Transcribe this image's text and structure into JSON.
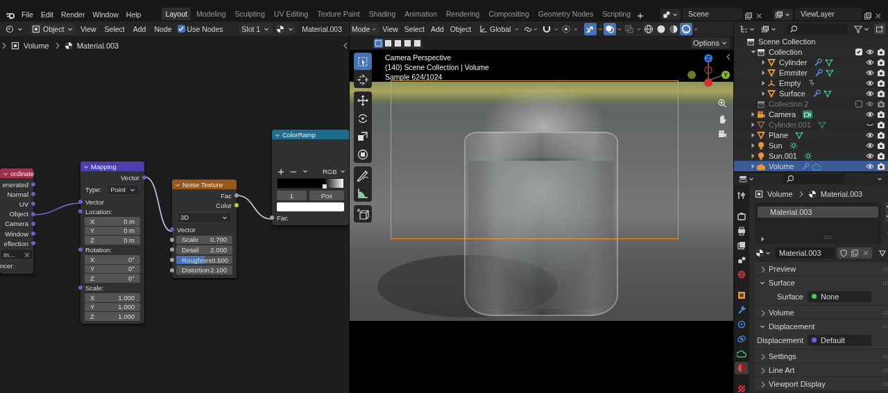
{
  "topbar": {
    "menus": [
      "File",
      "Edit",
      "Render",
      "Window",
      "Help"
    ],
    "workspaces": [
      {
        "label": "Layout",
        "selected": true
      },
      {
        "label": "Modeling",
        "selected": false
      },
      {
        "label": "Sculpting",
        "selected": false
      },
      {
        "label": "UV Editing",
        "selected": false
      },
      {
        "label": "Texture Paint",
        "selected": false
      },
      {
        "label": "Shading",
        "selected": false
      },
      {
        "label": "Animation",
        "selected": false
      },
      {
        "label": "Rendering",
        "selected": false
      },
      {
        "label": "Compositing",
        "selected": false
      },
      {
        "label": "Geometry Nodes",
        "selected": false
      },
      {
        "label": "Scripting",
        "selected": false
      }
    ],
    "scene": "Scene",
    "view_layer": "ViewLayer"
  },
  "node_editor": {
    "header": {
      "mode": "Object",
      "menus": [
        "View",
        "Select",
        "Add",
        "Node"
      ],
      "use_nodes": {
        "label": "Use Nodes",
        "checked": true
      },
      "slot": "Slot 1",
      "material": "Material.003"
    },
    "breadcrumb": [
      "Volume",
      "Material.003"
    ],
    "nodes": [
      {
        "title": "ordinate",
        "color": "#a3304a",
        "rows": [
          {
            "kind": "output",
            "label": "enerated",
            "color": "#6363c7"
          },
          {
            "kind": "output",
            "label": "Normal",
            "color": "#6363c7"
          },
          {
            "kind": "output",
            "label": "UV",
            "color": "#6363c7"
          },
          {
            "kind": "output",
            "label": "Object",
            "color": "#6363c7"
          },
          {
            "kind": "output",
            "label": "Camera",
            "color": "#6363c7"
          },
          {
            "kind": "output",
            "label": "Window",
            "color": "#6363c7"
          },
          {
            "kind": "output",
            "label": "eflection",
            "color": "#6363c7"
          },
          {
            "kind": "object",
            "value": "m…"
          },
          {
            "kind": "text",
            "label": "ncer"
          }
        ]
      },
      {
        "title": "Mapping",
        "color": "#4a40b0",
        "rows": [
          {
            "kind": "output",
            "label": "Vector",
            "color": "#6363c7"
          },
          {
            "kind": "dropdown",
            "label": "Type:",
            "value": "Point"
          },
          {
            "kind": "input",
            "label": "Vector",
            "color": "#6363c7"
          },
          {
            "kind": "input",
            "label": "Location:",
            "color": "#6363c7"
          },
          {
            "kind": "field",
            "label": "X",
            "value": "0 m"
          },
          {
            "kind": "field",
            "label": "Y",
            "value": "0 m"
          },
          {
            "kind": "field",
            "label": "Z",
            "value": "0 m"
          },
          {
            "kind": "input",
            "label": "Rotation:",
            "color": "#6363c7"
          },
          {
            "kind": "field",
            "label": "X",
            "value": "0°"
          },
          {
            "kind": "field",
            "label": "Y",
            "value": "0°"
          },
          {
            "kind": "field",
            "label": "Z",
            "value": "0°"
          },
          {
            "kind": "input",
            "label": "Scale:",
            "color": "#6363c7"
          },
          {
            "kind": "field",
            "label": "X",
            "value": "1.000"
          },
          {
            "kind": "field",
            "label": "Y",
            "value": "1.000"
          },
          {
            "kind": "field",
            "label": "Z",
            "value": "1.000"
          }
        ]
      },
      {
        "title": "Noise Texture",
        "color": "#96581c",
        "rows": [
          {
            "kind": "output",
            "label": "Fac",
            "color": "#a1a1a1"
          },
          {
            "kind": "output",
            "label": "Color",
            "color": "#c7c729"
          },
          {
            "kind": "dropdown",
            "value": "3D"
          },
          {
            "kind": "input",
            "label": "Vector",
            "color": "#6363c7"
          },
          {
            "kind": "slider",
            "label": "Scale",
            "value": "0.700",
            "color": "#a1a1a1"
          },
          {
            "kind": "slider",
            "label": "Detail",
            "value": "2.000",
            "color": "#a1a1a1"
          },
          {
            "kind": "slider",
            "label": "Roughnes",
            "value": "0.500",
            "color": "#a1a1a1",
            "level": 0.5
          },
          {
            "kind": "slider",
            "label": "Distortion",
            "value": "2.100",
            "color": "#a1a1a1"
          }
        ]
      },
      {
        "title": "ColorRamp",
        "color": "#1f6d8c",
        "rows": [
          {
            "kind": "ramp-controls",
            "mode": "RGB"
          },
          {
            "kind": "gradient",
            "level": 0.7
          },
          {
            "kind": "ramp-stop",
            "index": "1",
            "position": "Pos"
          },
          {
            "kind": "swatch",
            "color": "#ffffff"
          },
          {
            "kind": "input",
            "label": "Fac",
            "color": "#a1a1a1"
          }
        ]
      }
    ]
  },
  "viewport": {
    "header": {
      "mode": "Mode",
      "menus": [
        "View",
        "Select",
        "Add",
        "Object"
      ],
      "orientation": "Global",
      "toggles": [
        {
          "kind": "snap",
          "on": false
        },
        {
          "kind": "proportional",
          "on": false
        },
        {
          "kind": "gizmos",
          "on": true
        },
        {
          "kind": "overlays",
          "on": true
        },
        {
          "kind": "xray",
          "on": false
        }
      ],
      "shading": [
        {
          "kind": "wireframe",
          "selected": false
        },
        {
          "kind": "solid",
          "selected": false
        },
        {
          "kind": "material",
          "selected": false
        },
        {
          "kind": "rendered",
          "selected": true
        }
      ]
    },
    "select_modes": [
      {
        "selected": true
      },
      {
        "selected": false
      },
      {
        "selected": false
      },
      {
        "selected": false
      },
      {
        "selected": false
      }
    ],
    "options": "Options",
    "overlay": [
      "Camera Perspective",
      "(140) Scene Collection | Volume",
      "Sample 624/1024"
    ],
    "tools": [
      {
        "kind": "select",
        "selected": true
      },
      {
        "kind": "cursor",
        "selected": false
      },
      {
        "kind": "move",
        "selected": false
      },
      {
        "kind": "rotate",
        "selected": false
      },
      {
        "kind": "scale",
        "selected": false
      },
      {
        "kind": "transform",
        "selected": false
      },
      {
        "kind": "annotate",
        "selected": false
      },
      {
        "kind": "measure",
        "selected": false
      },
      {
        "kind": "add-cube",
        "selected": false
      }
    ],
    "gizmo": {
      "z": "Z",
      "y": "Y"
    }
  },
  "outliner": {
    "tree": [
      {
        "name": "Scene Collection",
        "kind": "scene",
        "selected": false,
        "children": [
          {
            "name": "Collection",
            "kind": "collection",
            "expanded": true,
            "included": true,
            "selected": false,
            "children": [
              {
                "name": "Cylinder",
                "kind": "mesh",
                "expanded": false,
                "modifier": true,
                "visible": true,
                "selected": false
              },
              {
                "name": "Emmiter",
                "kind": "mesh",
                "expanded": false,
                "modifier": true,
                "visible": true,
                "selected": false
              },
              {
                "name": "Empty",
                "kind": "empty",
                "expanded": false,
                "modifier": false,
                "visible": true,
                "selected": false
              },
              {
                "name": "Surface",
                "kind": "mesh",
                "expanded": false,
                "modifier": true,
                "visible": true,
                "selected": false
              }
            ]
          },
          {
            "name": "Collection 2",
            "kind": "collection",
            "included": false,
            "selected": false
          },
          {
            "name": "Camera",
            "kind": "camera",
            "expanded": false,
            "modifier": false,
            "visible": true,
            "selected": false
          },
          {
            "name": "Cylinder.001",
            "kind": "mesh",
            "expanded": false,
            "modifier": false,
            "visible": false,
            "selected": false
          },
          {
            "name": "Plane",
            "kind": "mesh",
            "expanded": false,
            "modifier": false,
            "visible": true,
            "selected": false
          },
          {
            "name": "Sun",
            "kind": "light",
            "expanded": false,
            "modifier": false,
            "visible": true,
            "selected": false
          },
          {
            "name": "Sun.001",
            "kind": "light",
            "expanded": false,
            "modifier": false,
            "visible": true,
            "selected": false
          },
          {
            "name": "Volume",
            "kind": "volume",
            "expanded": false,
            "modifier": true,
            "visible": true,
            "selected": true
          }
        ]
      }
    ]
  },
  "properties": {
    "tabs": [
      {
        "kind": "tool",
        "selected": false
      },
      {
        "kind": "render",
        "selected": false
      },
      {
        "kind": "output",
        "selected": false
      },
      {
        "kind": "view_layer",
        "selected": false
      },
      {
        "kind": "scene",
        "selected": false
      },
      {
        "kind": "world",
        "selected": false
      },
      {
        "kind": "object",
        "selected": false
      },
      {
        "kind": "modifiers",
        "selected": false
      },
      {
        "kind": "particles",
        "selected": false
      },
      {
        "kind": "physics",
        "selected": false
      },
      {
        "kind": "data",
        "selected": false
      },
      {
        "kind": "material",
        "selected": true
      },
      {
        "kind": "texture",
        "selected": false
      }
    ],
    "breadcrumb": [
      "Volume",
      "Material.003"
    ],
    "slots": [
      {
        "name": "Material.003",
        "selected": true
      }
    ],
    "material": "Material.003",
    "panels": [
      {
        "title": "Preview",
        "expanded": false
      },
      {
        "title": "Surface",
        "expanded": true,
        "fields": [
          {
            "label": "Surface",
            "value": "None",
            "color": "#4ec94e"
          }
        ]
      },
      {
        "title": "Volume",
        "expanded": false
      },
      {
        "title": "Displacement",
        "expanded": true,
        "fields": [
          {
            "label": "Displacement",
            "value": "Default",
            "color": "#7060d8"
          }
        ]
      },
      {
        "title": "Settings",
        "expanded": false
      },
      {
        "title": "Line Art",
        "expanded": false
      },
      {
        "title": "Viewport Display",
        "expanded": false
      }
    ]
  }
}
